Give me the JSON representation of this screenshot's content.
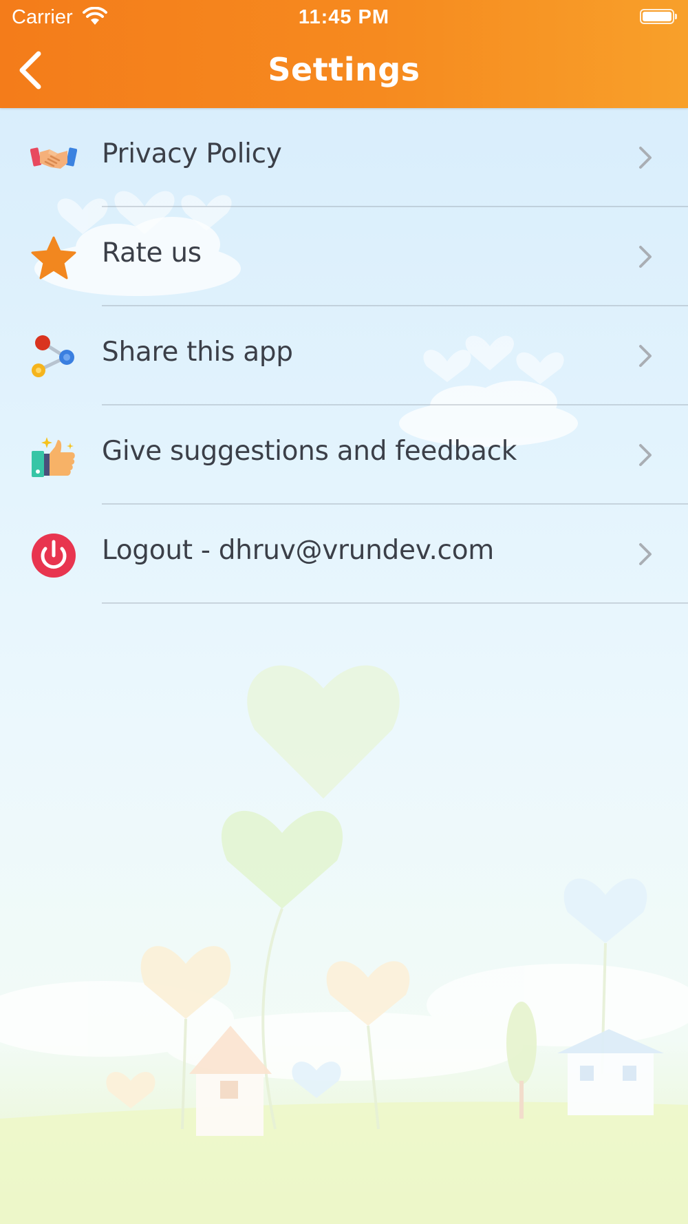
{
  "status_bar": {
    "carrier": "Carrier",
    "time": "11:45 PM"
  },
  "header": {
    "title": "Settings",
    "back_icon": "chevron-left-icon"
  },
  "colors": {
    "header_start": "#f47c1a",
    "header_end": "#f8a02a",
    "label_text": "#3b3f48",
    "chevron": "#a9aeb4"
  },
  "settings": {
    "items": [
      {
        "label": "Privacy Policy",
        "icon": "handshake-icon"
      },
      {
        "label": "Rate us",
        "icon": "star-icon"
      },
      {
        "label": "Share this app",
        "icon": "share-icon"
      },
      {
        "label": "Give suggestions and feedback",
        "icon": "thumbs-up-icon"
      },
      {
        "label": "Logout - dhruv@vrundev.com",
        "icon": "power-icon"
      }
    ]
  }
}
